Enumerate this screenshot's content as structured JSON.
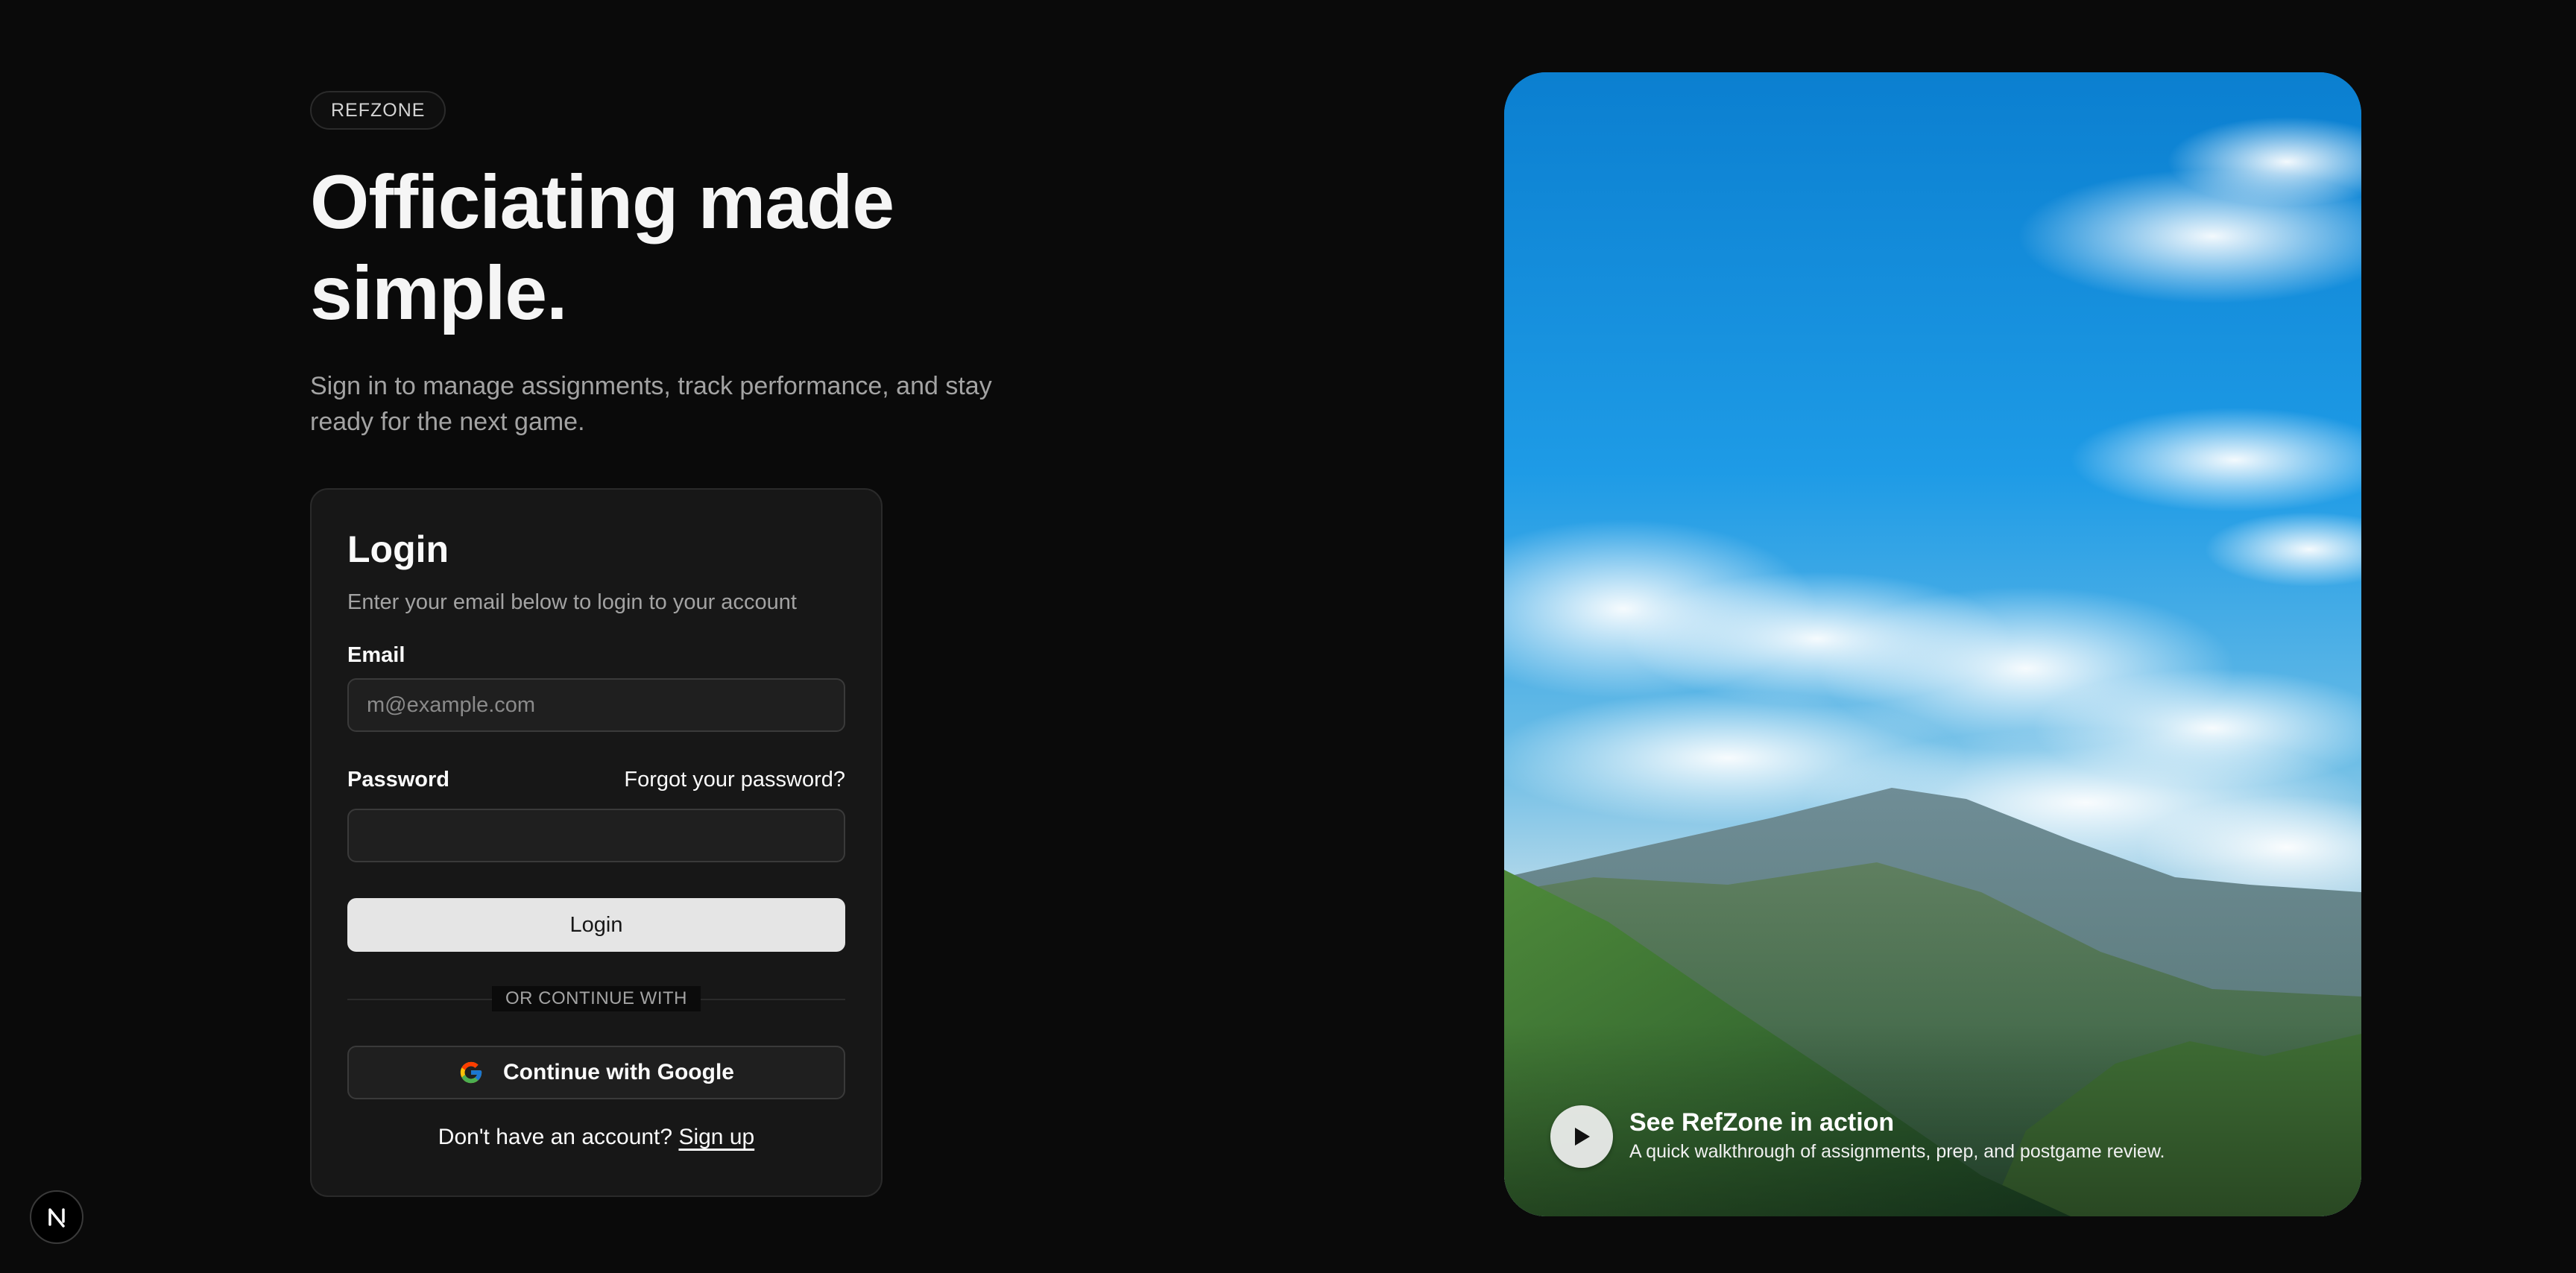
{
  "brand": {
    "label": "REFZONE"
  },
  "hero": {
    "title": "Officiating made simple.",
    "subtitle": "Sign in to manage assignments, track performance, and stay ready for the next game."
  },
  "login": {
    "title": "Login",
    "description": "Enter your email below to login to your account",
    "email_label": "Email",
    "email_placeholder": "m@example.com",
    "email_value": "",
    "password_label": "Password",
    "forgot_label": "Forgot your password?",
    "password_value": "",
    "submit_label": "Login",
    "divider_label": "OR CONTINUE WITH",
    "google_label": "Continue with Google",
    "signup_prompt": "Don't have an account?",
    "signup_label": "Sign up"
  },
  "media": {
    "title": "See RefZone in action",
    "subtitle": "A quick walkthrough of assignments, prep, and postgame review."
  },
  "icons": {
    "google": "google-icon",
    "play": "play-icon",
    "corner": "n-logo-icon"
  },
  "colors": {
    "background": "#0a0a0a",
    "card": "#171717",
    "primary_button": "#e5e5e5",
    "text": "#fafafa",
    "muted": "#a3a3a3"
  }
}
